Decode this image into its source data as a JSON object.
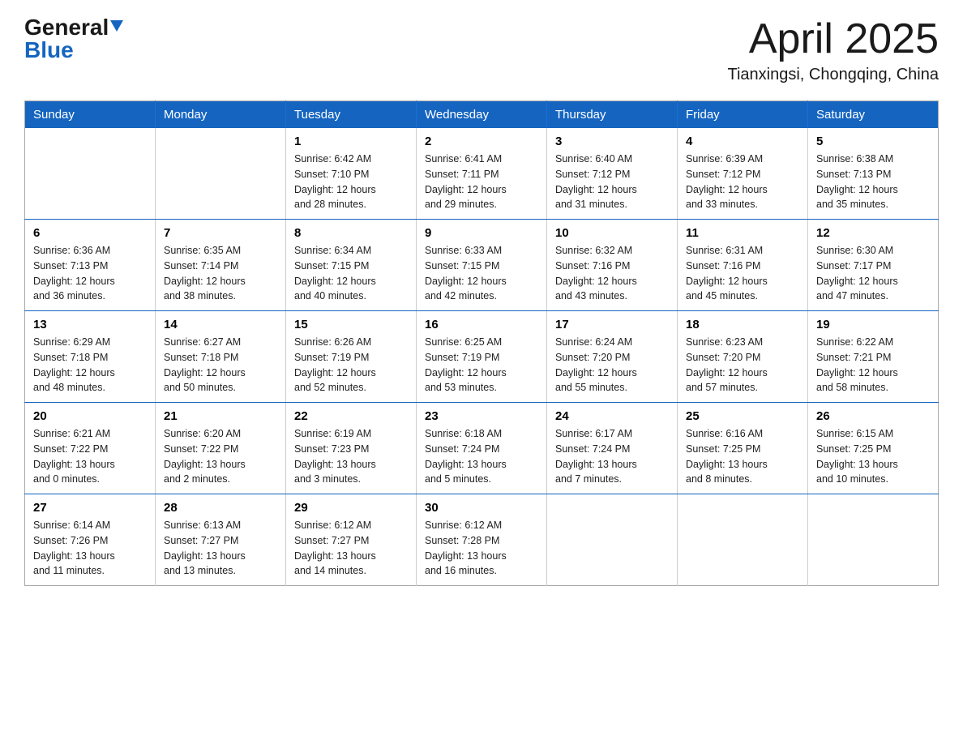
{
  "header": {
    "logo_general": "General",
    "logo_blue": "Blue",
    "month_title": "April 2025",
    "location": "Tianxingsi, Chongqing, China"
  },
  "days_of_week": [
    "Sunday",
    "Monday",
    "Tuesday",
    "Wednesday",
    "Thursday",
    "Friday",
    "Saturday"
  ],
  "weeks": [
    [
      {
        "day": "",
        "info": ""
      },
      {
        "day": "",
        "info": ""
      },
      {
        "day": "1",
        "info": "Sunrise: 6:42 AM\nSunset: 7:10 PM\nDaylight: 12 hours\nand 28 minutes."
      },
      {
        "day": "2",
        "info": "Sunrise: 6:41 AM\nSunset: 7:11 PM\nDaylight: 12 hours\nand 29 minutes."
      },
      {
        "day": "3",
        "info": "Sunrise: 6:40 AM\nSunset: 7:12 PM\nDaylight: 12 hours\nand 31 minutes."
      },
      {
        "day": "4",
        "info": "Sunrise: 6:39 AM\nSunset: 7:12 PM\nDaylight: 12 hours\nand 33 minutes."
      },
      {
        "day": "5",
        "info": "Sunrise: 6:38 AM\nSunset: 7:13 PM\nDaylight: 12 hours\nand 35 minutes."
      }
    ],
    [
      {
        "day": "6",
        "info": "Sunrise: 6:36 AM\nSunset: 7:13 PM\nDaylight: 12 hours\nand 36 minutes."
      },
      {
        "day": "7",
        "info": "Sunrise: 6:35 AM\nSunset: 7:14 PM\nDaylight: 12 hours\nand 38 minutes."
      },
      {
        "day": "8",
        "info": "Sunrise: 6:34 AM\nSunset: 7:15 PM\nDaylight: 12 hours\nand 40 minutes."
      },
      {
        "day": "9",
        "info": "Sunrise: 6:33 AM\nSunset: 7:15 PM\nDaylight: 12 hours\nand 42 minutes."
      },
      {
        "day": "10",
        "info": "Sunrise: 6:32 AM\nSunset: 7:16 PM\nDaylight: 12 hours\nand 43 minutes."
      },
      {
        "day": "11",
        "info": "Sunrise: 6:31 AM\nSunset: 7:16 PM\nDaylight: 12 hours\nand 45 minutes."
      },
      {
        "day": "12",
        "info": "Sunrise: 6:30 AM\nSunset: 7:17 PM\nDaylight: 12 hours\nand 47 minutes."
      }
    ],
    [
      {
        "day": "13",
        "info": "Sunrise: 6:29 AM\nSunset: 7:18 PM\nDaylight: 12 hours\nand 48 minutes."
      },
      {
        "day": "14",
        "info": "Sunrise: 6:27 AM\nSunset: 7:18 PM\nDaylight: 12 hours\nand 50 minutes."
      },
      {
        "day": "15",
        "info": "Sunrise: 6:26 AM\nSunset: 7:19 PM\nDaylight: 12 hours\nand 52 minutes."
      },
      {
        "day": "16",
        "info": "Sunrise: 6:25 AM\nSunset: 7:19 PM\nDaylight: 12 hours\nand 53 minutes."
      },
      {
        "day": "17",
        "info": "Sunrise: 6:24 AM\nSunset: 7:20 PM\nDaylight: 12 hours\nand 55 minutes."
      },
      {
        "day": "18",
        "info": "Sunrise: 6:23 AM\nSunset: 7:20 PM\nDaylight: 12 hours\nand 57 minutes."
      },
      {
        "day": "19",
        "info": "Sunrise: 6:22 AM\nSunset: 7:21 PM\nDaylight: 12 hours\nand 58 minutes."
      }
    ],
    [
      {
        "day": "20",
        "info": "Sunrise: 6:21 AM\nSunset: 7:22 PM\nDaylight: 13 hours\nand 0 minutes."
      },
      {
        "day": "21",
        "info": "Sunrise: 6:20 AM\nSunset: 7:22 PM\nDaylight: 13 hours\nand 2 minutes."
      },
      {
        "day": "22",
        "info": "Sunrise: 6:19 AM\nSunset: 7:23 PM\nDaylight: 13 hours\nand 3 minutes."
      },
      {
        "day": "23",
        "info": "Sunrise: 6:18 AM\nSunset: 7:24 PM\nDaylight: 13 hours\nand 5 minutes."
      },
      {
        "day": "24",
        "info": "Sunrise: 6:17 AM\nSunset: 7:24 PM\nDaylight: 13 hours\nand 7 minutes."
      },
      {
        "day": "25",
        "info": "Sunrise: 6:16 AM\nSunset: 7:25 PM\nDaylight: 13 hours\nand 8 minutes."
      },
      {
        "day": "26",
        "info": "Sunrise: 6:15 AM\nSunset: 7:25 PM\nDaylight: 13 hours\nand 10 minutes."
      }
    ],
    [
      {
        "day": "27",
        "info": "Sunrise: 6:14 AM\nSunset: 7:26 PM\nDaylight: 13 hours\nand 11 minutes."
      },
      {
        "day": "28",
        "info": "Sunrise: 6:13 AM\nSunset: 7:27 PM\nDaylight: 13 hours\nand 13 minutes."
      },
      {
        "day": "29",
        "info": "Sunrise: 6:12 AM\nSunset: 7:27 PM\nDaylight: 13 hours\nand 14 minutes."
      },
      {
        "day": "30",
        "info": "Sunrise: 6:12 AM\nSunset: 7:28 PM\nDaylight: 13 hours\nand 16 minutes."
      },
      {
        "day": "",
        "info": ""
      },
      {
        "day": "",
        "info": ""
      },
      {
        "day": "",
        "info": ""
      }
    ]
  ]
}
